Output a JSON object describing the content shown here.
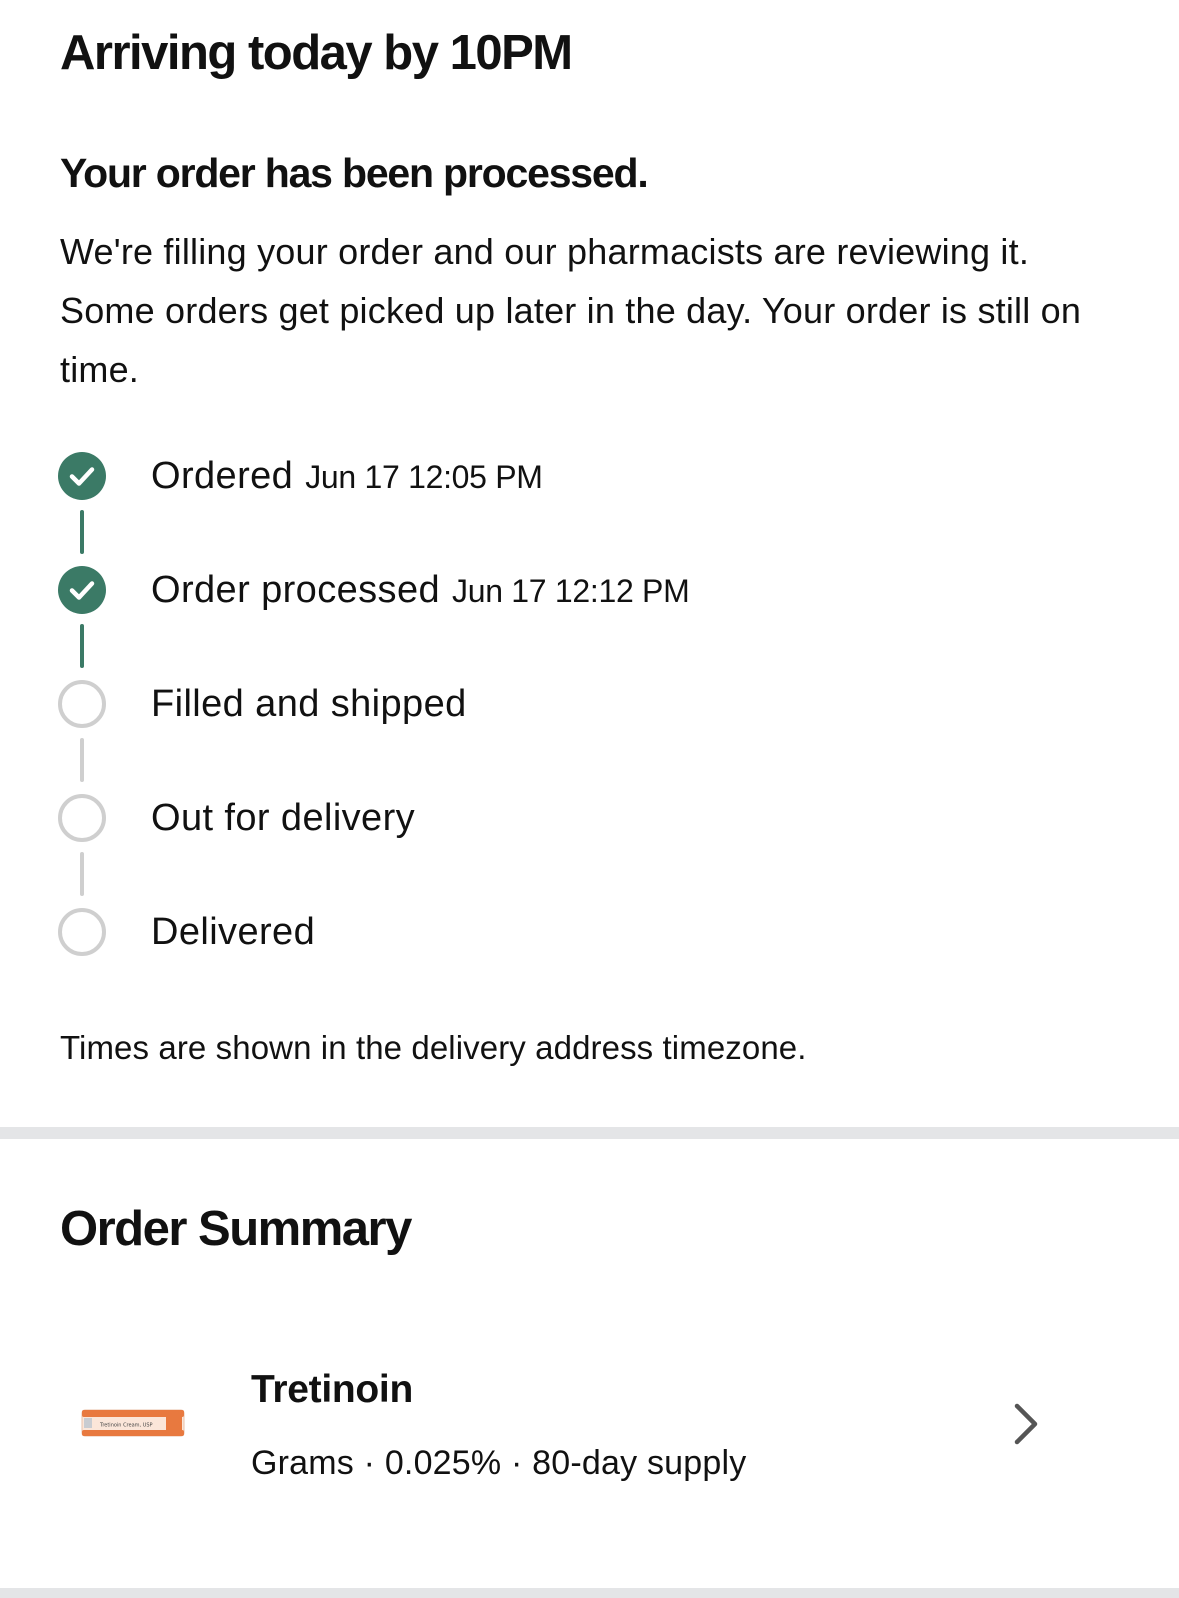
{
  "delivery": {
    "eta_title": "Arriving today by 10PM"
  },
  "status": {
    "heading": "Your order has been processed.",
    "message": "We're filling your order and our pharmacists are reviewing it. Some orders get picked up later in the day. Your order is still on time."
  },
  "tracker": {
    "steps": [
      {
        "label": "Ordered",
        "time": "Jun 17 12:05 PM",
        "state": "complete"
      },
      {
        "label": "Order processed",
        "time": "Jun 17 12:12 PM",
        "state": "complete"
      },
      {
        "label": "Filled and shipped",
        "time": "",
        "state": "pending"
      },
      {
        "label": "Out for delivery",
        "time": "",
        "state": "pending"
      },
      {
        "label": "Delivered",
        "time": "",
        "state": "pending"
      }
    ],
    "timezone_note": "Times are shown in the delivery address timezone."
  },
  "summary": {
    "heading": "Order Summary",
    "item": {
      "name": "Tretinoin",
      "details": "Grams · 0.025% · 80-day supply",
      "image_icon": "medicine-tube-image",
      "image_text": "Tretinoin Cream, USP"
    }
  },
  "colors": {
    "complete": "#3b7a66",
    "pending": "#cfcfcf",
    "divider": "#e4e5e7",
    "tube_accent": "#e8793f"
  }
}
